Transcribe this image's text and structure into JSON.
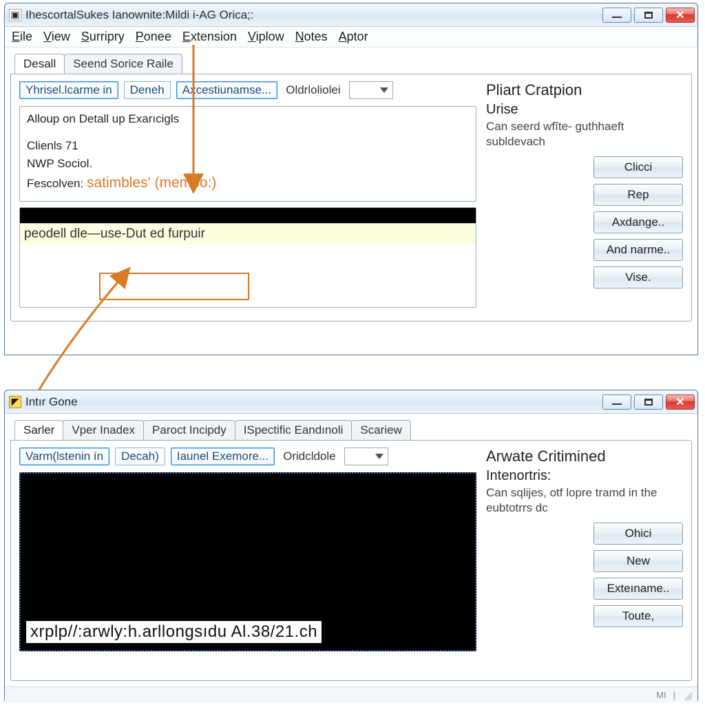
{
  "win1": {
    "title": "IhescortalSukes  Ianownite:Mildi i-AG Orica;:",
    "menus": [
      "Eile",
      "View",
      "Surripry",
      "Ponee",
      "Extension",
      "Viplow",
      "Notes",
      "Aptor"
    ],
    "tabs": [
      "Desall",
      "Seend Sorice Raile"
    ],
    "toolbar": {
      "b1": "Yhrisel.lcarme in",
      "b2": "Deneh",
      "b3": "Axcestiunamse...",
      "b4": "Oldrloliolei"
    },
    "group": {
      "legend": "Alloup on Detall up Exarıcigls",
      "line1": "Clienls 71",
      "line2": "NWP Sociol.",
      "line3a": "Fescolven:",
      "line3b": "satimbles' (membo:)"
    },
    "row": "peodell dle—use-Dut ed furpuir",
    "side": {
      "h1": "Pliart Cratpion",
      "h2": "Urise",
      "text": "Can seerd wfîte-  guthhaeft subldevach"
    },
    "buttons": [
      "Clicci",
      "Rep",
      "Axdange..",
      "And narme..",
      "Vise."
    ]
  },
  "win2": {
    "title": "Intır Gone",
    "tabs": [
      "Sarler",
      "Vper Inadex",
      "Paroct Incipdy",
      "ISpectific Eandınoli",
      "Scariew"
    ],
    "toolbar": {
      "b1": "Varm(lstenin ín",
      "b2": "Decah)",
      "b3": "Iaunel Exemore...",
      "b4": "Oridcldole"
    },
    "url": "xrplp//:arwly:h.arllongsıdu Al.38/21.ch",
    "side": {
      "h1": "Arwate Critimined",
      "h2": "Intenortris:",
      "text": "Can sqlijes, otf lopre tramd in the eubtotrrs dc"
    },
    "buttons": [
      "Ohici",
      "New",
      "Exteıname..",
      "Toute,"
    ],
    "status": "MI"
  },
  "colors": {
    "accent": "#d77b27"
  }
}
